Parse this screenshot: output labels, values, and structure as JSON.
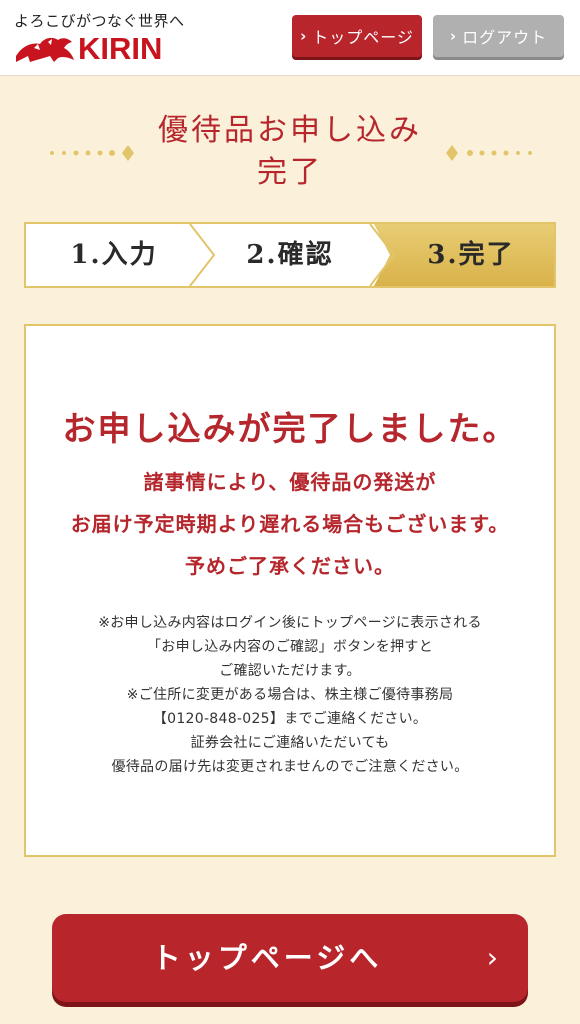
{
  "header": {
    "tagline": "よろこびがつなぐ世界へ",
    "logo_text": "KIRIN",
    "top_button": "トップページ",
    "logout_button": "ログアウト",
    "chevron": "›"
  },
  "title": {
    "line1": "優待品お申し込み",
    "line2": "完了"
  },
  "steps": [
    {
      "label": "1.入力"
    },
    {
      "label": "2.確認"
    },
    {
      "label": "3.完了"
    }
  ],
  "content": {
    "headline": "お申し込みが完了しました。",
    "sub": [
      "諸事情により、優待品の発送が",
      "お届け予定時期より遅れる場合もございます。",
      "予めご了承ください。"
    ],
    "notes": [
      "※お申し込み内容はログイン後にトップページに表示される",
      "「お申し込み内容のご確認」ボタンを押すと",
      "ご確認いただけます。",
      "※ご住所に変更がある場合は、株主様ご優待事務局",
      "【0120-848-025】までご連絡ください。",
      "証券会社にご連絡いただいても",
      "優待品の届け先は変更されませんのでご注意ください。"
    ]
  },
  "bottom_button": {
    "label": "トップページへ",
    "arrow": "›"
  },
  "colors": {
    "accent_red": "#b5272d",
    "gold": "#e2c56a",
    "background": "#fbf1da"
  }
}
